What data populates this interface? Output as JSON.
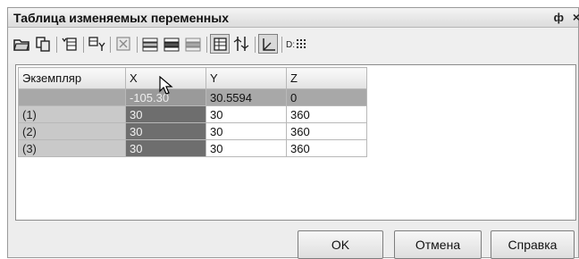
{
  "window": {
    "title": "Таблица изменяемых переменных",
    "pin": "ф",
    "close": "×"
  },
  "toolbar": {
    "icons": [
      "open-icon",
      "copy-icon",
      "insert-column-icon",
      "formula-icon",
      "delete-icon",
      "add-row-icon",
      "insert-row-icon",
      "remove-row-icon",
      "table-view-icon",
      "adjust-icon",
      "axes-icon",
      "grid-dots-icon"
    ],
    "dots_label": "D:"
  },
  "grid": {
    "headers": [
      "Экземпляр",
      "X",
      "Y",
      "Z"
    ],
    "rows": [
      {
        "name": "",
        "x": "-105.30",
        "y": "30.5594",
        "z": "0"
      },
      {
        "name": "(1)",
        "x": "30",
        "y": "30",
        "z": "360"
      },
      {
        "name": "(2)",
        "x": "30",
        "y": "30",
        "z": "360"
      },
      {
        "name": "(3)",
        "x": "30",
        "y": "30",
        "z": "360"
      }
    ]
  },
  "buttons": {
    "ok": "OK",
    "cancel": "Отмена",
    "help": "Справка"
  }
}
